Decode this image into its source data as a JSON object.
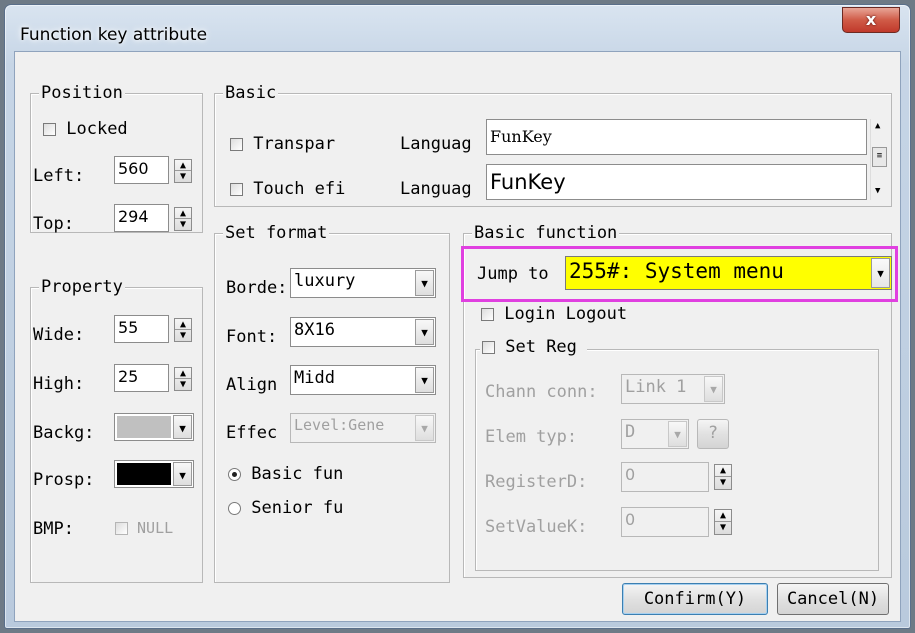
{
  "window": {
    "title": "Function key attribute",
    "close_glyph": "x"
  },
  "position": {
    "group_label": "Position",
    "locked_label": "Locked",
    "left_label": "Left:",
    "left_value": "560",
    "top_label": "Top:",
    "top_value": "294"
  },
  "property": {
    "group_label": "Property",
    "wide_label": "Wide:",
    "wide_value": "55",
    "high_label": "High:",
    "high_value": "25",
    "backg_label": "Backg:",
    "backg_color": "#c0c0c0",
    "prosp_label": "Prosp:",
    "prosp_color": "#000000",
    "bmp_label": "BMP:",
    "bmp_value": "NULL"
  },
  "basic": {
    "group_label": "Basic",
    "transpar_label": "Transpar",
    "touch_label": "Touch efi",
    "language1_label": "Languag",
    "language1_value": "FunKey",
    "language2_label": "Languag",
    "language2_value": "FunKey"
  },
  "set_format": {
    "group_label": "Set format",
    "border_label": "Borde:",
    "border_value": "luxury",
    "font_label": "Font:",
    "font_value": "8X16",
    "align_label": "Align",
    "align_value": "Midd",
    "effect_label": "Effec",
    "effect_value": "Level:Gene",
    "basic_fun_label": "Basic fun",
    "senior_fu_label": "Senior fu"
  },
  "basic_function": {
    "group_label": "Basic function",
    "jump_label": "Jump to",
    "jump_value": "255#: System menu",
    "highlight_color": "#ffff00",
    "callout_color": "#e040e0",
    "login_label": "Login Logout",
    "set_reg_label": "Set Reg",
    "chann_label": "Chann conn:",
    "chann_value": "Link 1",
    "elem_label": "Elem typ:",
    "elem_value": "D",
    "elem_help": "?",
    "register_label": "RegisterD:",
    "register_value": "0",
    "setvalue_label": "SetValueK:",
    "setvalue_value": "0"
  },
  "buttons": {
    "confirm": "Confirm(Y)",
    "cancel": "Cancel(N)"
  },
  "icons": {
    "spin": "spin-updown-icon",
    "combo": "chevron-down-icon",
    "close": "close-icon"
  }
}
